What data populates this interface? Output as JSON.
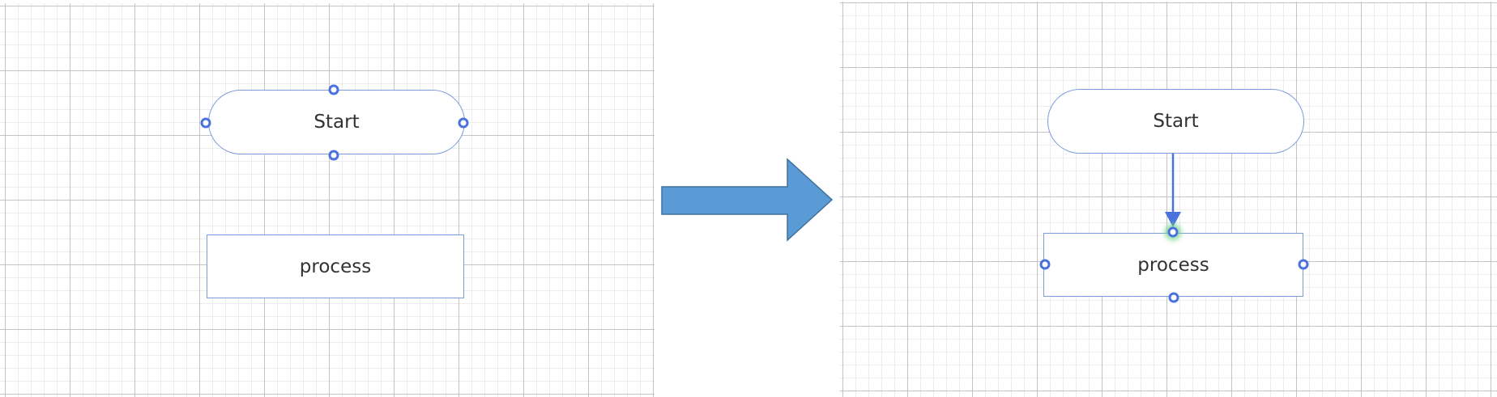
{
  "before": {
    "start_label": "Start",
    "process_label": "process"
  },
  "after": {
    "start_label": "Start",
    "process_label": "process"
  },
  "colors": {
    "shape_border": "#7d9bdc",
    "handle": "#4a72dc",
    "connector": "#4a72dc",
    "connection_glow": "#76d68c",
    "transition_arrow": "#5b9bd5",
    "transition_arrow_border": "#41719c"
  }
}
